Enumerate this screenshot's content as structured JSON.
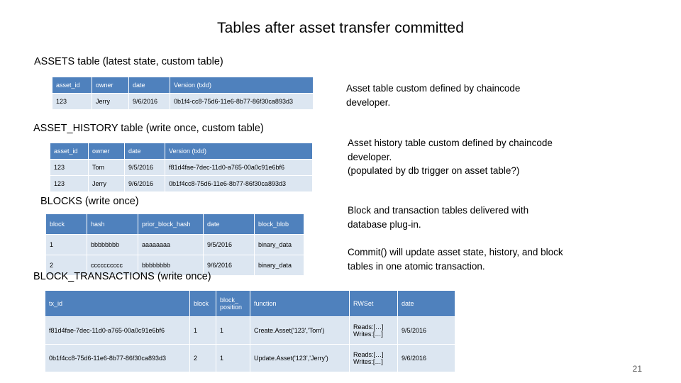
{
  "slide": {
    "title": "Tables after asset transfer committed",
    "page_number": "21"
  },
  "labels": {
    "assets": "ASSETS table (latest state, custom table)",
    "asset_history": "ASSET_HISTORY table (write once, custom table)",
    "blocks": "BLOCKS (write once)",
    "block_transactions": "BLOCK_TRANSACTIONS (write once)"
  },
  "captions": {
    "assets": "Asset table custom defined by chaincode developer.",
    "asset_history": "Asset history table custom defined by chaincode developer.\n(populated by db trigger on asset table?)",
    "blocks": "Block and transaction tables delivered with database plug-in.",
    "commit": "Commit() will update asset state, history, and block tables in one atomic transaction."
  },
  "tables": {
    "assets": {
      "headers": [
        "asset_id",
        "owner",
        "date",
        "Version (txId)"
      ],
      "rows": [
        [
          "123",
          "Jerry",
          "9/6/2016",
          "0b1f4-cc8-75d6-11e6-8b77-86f30ca893d3"
        ]
      ]
    },
    "asset_history": {
      "headers": [
        "asset_id",
        "owner",
        "date",
        "Version (txId)"
      ],
      "rows": [
        [
          "123",
          "Tom",
          "9/5/2016",
          "f81d4fae-7dec-11d0-a765-00a0c91e6bf6"
        ],
        [
          "123",
          "Jerry",
          "9/6/2016",
          "0b1f4cc8-75d6-11e6-8b77-86f30ca893d3"
        ]
      ]
    },
    "blocks": {
      "headers": [
        "block",
        "hash",
        "prior_block_hash",
        "date",
        "block_blob"
      ],
      "rows": [
        [
          "1",
          "bbbbbbbb",
          "aaaaaaaa",
          "9/5/2016",
          "binary_data"
        ],
        [
          "2",
          "cccccccccc",
          "bbbbbbbb",
          "9/6/2016",
          "binary_data"
        ]
      ]
    },
    "block_transactions": {
      "headers": [
        "tx_id",
        "block",
        "block_ position",
        "function",
        "RWSet",
        "date"
      ],
      "rows": [
        [
          "f81d4fae-7dec-11d0-a765-00a0c91e6bf6",
          "1",
          "1",
          "Create.Asset('123','Tom')",
          "Reads:[…] Writes:[…]",
          "9/5/2016"
        ],
        [
          "0b1f4cc8-75d6-11e6-8b77-86f30ca893d3",
          "2",
          "1",
          "Update.Asset('123’,'Jerry')",
          "Reads:[…] Writes:[…]",
          "9/6/2016"
        ]
      ]
    }
  },
  "colors": {
    "header_fill": "#4f81bd",
    "cell_fill": "#dce6f1",
    "header_text": "#ffffff"
  }
}
